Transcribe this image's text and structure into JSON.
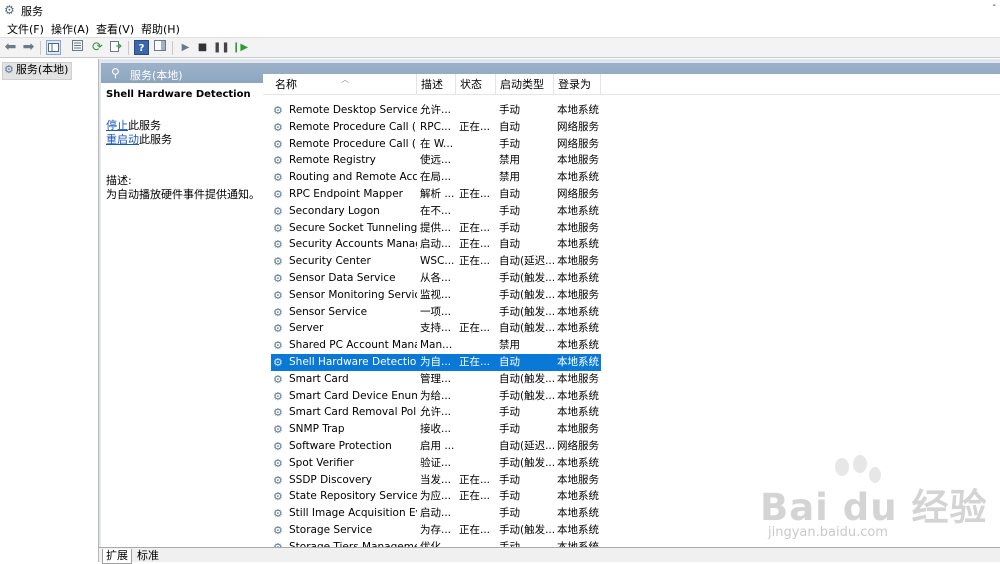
{
  "window": {
    "title": "服务",
    "control": "-"
  },
  "menu": [
    "文件(F)",
    "操作(A)",
    "查看(V)",
    "帮助(H)"
  ],
  "toolbar": {
    "buttons": [
      "back-icon",
      "forward-icon",
      "show-console-tree-icon",
      "properties-pane-icon",
      "refresh-icon",
      "export-list-icon",
      "help-icon",
      "action-pane-icon",
      "start-service-icon",
      "stop-service-icon",
      "pause-service-icon",
      "restart-service-icon"
    ]
  },
  "tree": {
    "root_label": "服务(本地)"
  },
  "panel": {
    "header": "服务(本地)"
  },
  "detail": {
    "service_name": "Shell Hardware Detection",
    "stop_link": "停止",
    "stop_suffix": "此服务",
    "restart_link": "重启动",
    "restart_suffix": "此服务",
    "desc_label": "描述:",
    "desc_text": "为自动播放硬件事件提供通知。"
  },
  "columns": [
    "名称",
    "描述",
    "状态",
    "启动类型",
    "登录为"
  ],
  "services": [
    {
      "name": "Remote Desktop Service...",
      "desc": "允许...",
      "status": "",
      "startup": "手动",
      "logon": "本地系统"
    },
    {
      "name": "Remote Procedure Call (...",
      "desc": "RPC...",
      "status": "正在...",
      "startup": "自动",
      "logon": "网络服务"
    },
    {
      "name": "Remote Procedure Call (...",
      "desc": "在 W...",
      "status": "",
      "startup": "手动",
      "logon": "网络服务"
    },
    {
      "name": "Remote Registry",
      "desc": "使远...",
      "status": "",
      "startup": "禁用",
      "logon": "本地服务"
    },
    {
      "name": "Routing and Remote Acc...",
      "desc": "在局...",
      "status": "",
      "startup": "禁用",
      "logon": "本地系统"
    },
    {
      "name": "RPC Endpoint Mapper",
      "desc": "解析 ...",
      "status": "正在...",
      "startup": "自动",
      "logon": "网络服务"
    },
    {
      "name": "Secondary Logon",
      "desc": "在不...",
      "status": "",
      "startup": "手动",
      "logon": "本地系统"
    },
    {
      "name": "Secure Socket Tunneling ...",
      "desc": "提供...",
      "status": "正在...",
      "startup": "手动",
      "logon": "本地服务"
    },
    {
      "name": "Security Accounts Manag...",
      "desc": "启动...",
      "status": "正在...",
      "startup": "自动",
      "logon": "本地系统"
    },
    {
      "name": "Security Center",
      "desc": "WSC...",
      "status": "正在...",
      "startup": "自动(延迟...",
      "logon": "本地服务"
    },
    {
      "name": "Sensor Data Service",
      "desc": "从各...",
      "status": "",
      "startup": "手动(触发...",
      "logon": "本地系统"
    },
    {
      "name": "Sensor Monitoring Service",
      "desc": "监视...",
      "status": "",
      "startup": "手动(触发...",
      "logon": "本地服务"
    },
    {
      "name": "Sensor Service",
      "desc": "一项...",
      "status": "",
      "startup": "手动(触发...",
      "logon": "本地系统"
    },
    {
      "name": "Server",
      "desc": "支持...",
      "status": "正在...",
      "startup": "自动(触发...",
      "logon": "本地系统"
    },
    {
      "name": "Shared PC Account Mana...",
      "desc": "Man...",
      "status": "",
      "startup": "禁用",
      "logon": "本地系统"
    },
    {
      "name": "Shell Hardware Detection",
      "desc": "为自...",
      "status": "正在...",
      "startup": "自动",
      "logon": "本地系统",
      "selected": true
    },
    {
      "name": "Smart Card",
      "desc": "管理...",
      "status": "",
      "startup": "自动(触发...",
      "logon": "本地服务"
    },
    {
      "name": "Smart Card Device Enum...",
      "desc": "为给...",
      "status": "",
      "startup": "手动(触发...",
      "logon": "本地系统"
    },
    {
      "name": "Smart Card Removal Poli...",
      "desc": "允许...",
      "status": "",
      "startup": "手动",
      "logon": "本地系统"
    },
    {
      "name": "SNMP Trap",
      "desc": "接收...",
      "status": "",
      "startup": "手动",
      "logon": "本地服务"
    },
    {
      "name": "Software Protection",
      "desc": "启用 ...",
      "status": "",
      "startup": "自动(延迟...",
      "logon": "网络服务"
    },
    {
      "name": "Spot Verifier",
      "desc": "验证...",
      "status": "",
      "startup": "手动(触发...",
      "logon": "本地系统"
    },
    {
      "name": "SSDP Discovery",
      "desc": "当发...",
      "status": "正在...",
      "startup": "手动",
      "logon": "本地服务"
    },
    {
      "name": "State Repository Service",
      "desc": "为应...",
      "status": "正在...",
      "startup": "手动",
      "logon": "本地系统"
    },
    {
      "name": "Still Image Acquisition Ev...",
      "desc": "启动...",
      "status": "",
      "startup": "手动",
      "logon": "本地系统"
    },
    {
      "name": "Storage Service",
      "desc": "为存...",
      "status": "正在...",
      "startup": "手动(触发...",
      "logon": "本地系统"
    },
    {
      "name": "Storage Tiers Management",
      "desc": "优化...",
      "status": "",
      "startup": "手动",
      "logon": "本地系统"
    }
  ],
  "tabs": [
    "扩展",
    "标准"
  ],
  "watermark": {
    "logo": "Bai du 经验",
    "url": "jingyan.baidu.com"
  },
  "colors": {
    "selection": "#0a78d7",
    "header": "#8ca5bf",
    "link": "#1a56c0"
  }
}
